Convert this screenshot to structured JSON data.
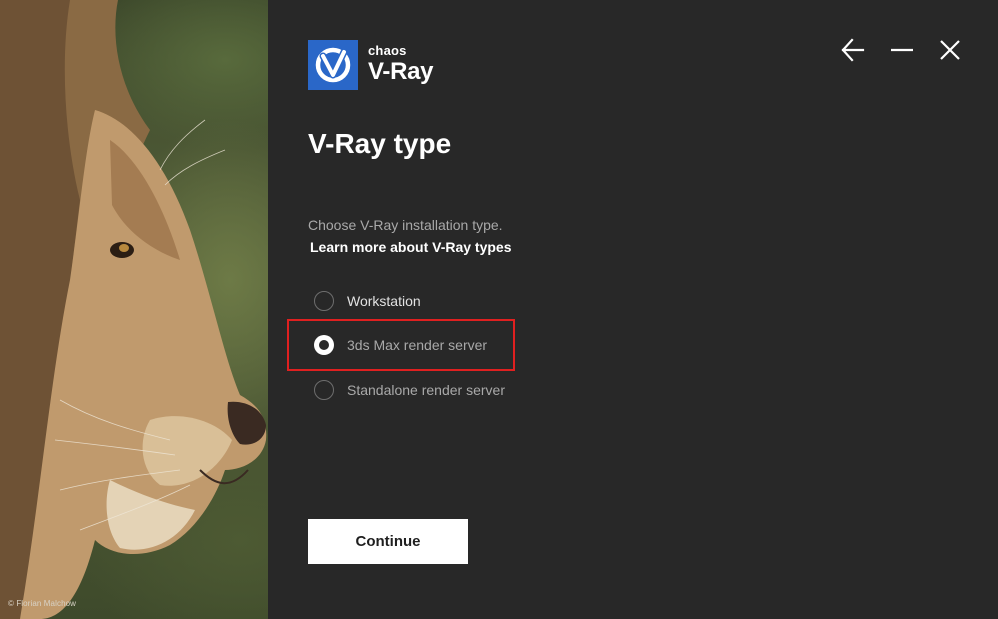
{
  "hero": {
    "photo_credit": "© Florian Malchow"
  },
  "logo": {
    "brand": "chaos",
    "product": "V-Ray",
    "icon": "vray-logo-icon"
  },
  "window_controls": {
    "back_icon": "arrow-left-icon",
    "minimize_icon": "minimize-icon",
    "close_icon": "close-icon"
  },
  "page": {
    "title": "V-Ray type",
    "subtitle": "Choose V-Ray installation type.",
    "learn_more_link": "Learn more about V-Ray types"
  },
  "options": [
    {
      "label": "Workstation",
      "selected": false
    },
    {
      "label": "3ds Max render server",
      "selected": true
    },
    {
      "label": "Standalone render server",
      "selected": false
    }
  ],
  "actions": {
    "continue_label": "Continue"
  },
  "colors": {
    "panel_background": "#282828",
    "accent_blue": "#2a67c8",
    "highlight_red": "#e02020",
    "primary_text": "#ffffff",
    "secondary_text": "#a9a9a9"
  }
}
